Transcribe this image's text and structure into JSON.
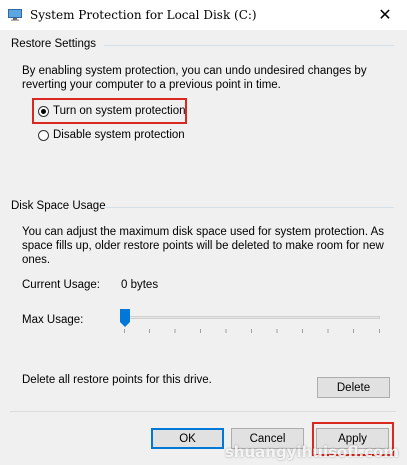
{
  "window": {
    "title": "System Protection for Local Disk (C:)",
    "close_glyph": "✕"
  },
  "restore_settings": {
    "heading": "Restore Settings",
    "description_line1": "By enabling system protection, you can undo undesired changes by",
    "description_line2": "reverting your computer to a previous point in time.",
    "options": [
      {
        "label": "Turn on system protection",
        "selected": true
      },
      {
        "label": "Disable system protection",
        "selected": false
      }
    ]
  },
  "disk_space": {
    "heading": "Disk Space Usage",
    "description_line1": "You can adjust the maximum disk space used for system protection. As",
    "description_line2": "space fills up, older restore points will be deleted to make room for new",
    "description_line3": "ones.",
    "current_usage_label": "Current Usage:",
    "current_usage_value": "0 bytes",
    "max_usage_label": "Max Usage:",
    "max_usage_fraction": 0,
    "delete_text": "Delete all restore points for this drive.",
    "delete_button": "Delete"
  },
  "buttons": {
    "ok": "OK",
    "cancel": "Cancel",
    "apply": "Apply"
  },
  "watermark": "shuangyihuisofl.com",
  "colors": {
    "highlight": "#d9281f",
    "accent": "#0078d7",
    "slider_thumb": "#0078d7"
  }
}
